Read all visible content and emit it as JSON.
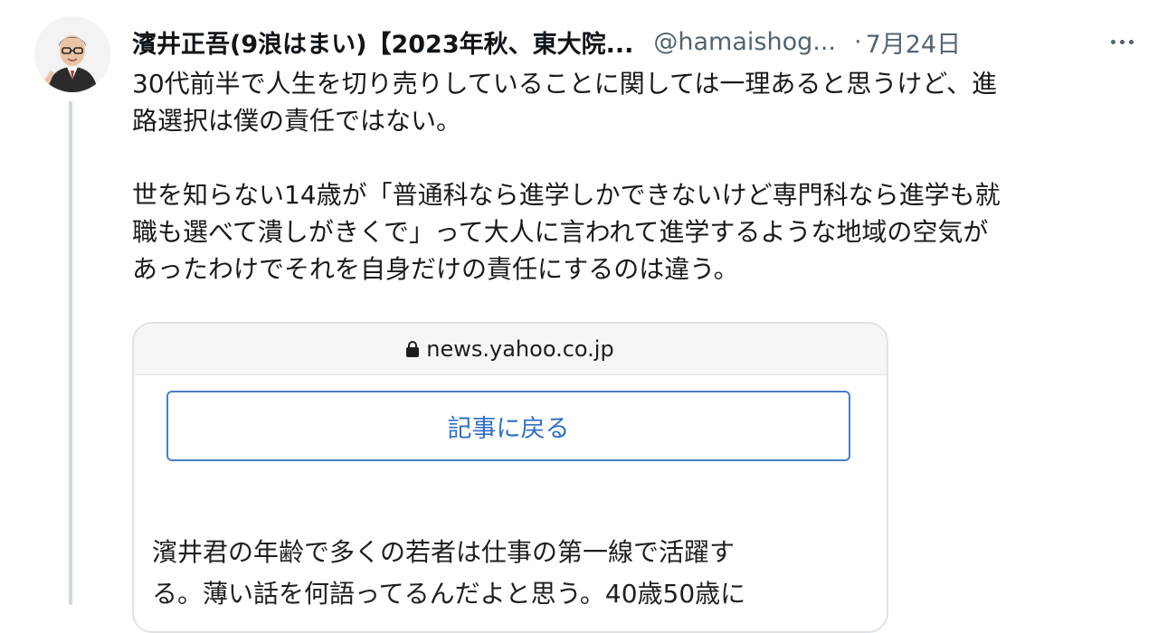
{
  "tweet": {
    "display_name": "濱井正吾(9浪はまい)【2023年秋、東大院...",
    "handle": "@hamaishog...",
    "separator": "·",
    "date": "7月24日",
    "body_lines": [
      "30代前半で人生を切り売りしていることに関しては一理あると思うけど、進",
      "路選択は僕の責任ではない。"
    ],
    "body_lines_2": [
      "世を知らない14歳が「普通科なら進学しかできないけど専門科なら進学も就",
      "職も選べて潰しがきくで」って大人に言われて進学するような地域の空気が",
      "あったわけでそれを自身だけの責任にするのは違う。"
    ]
  },
  "card": {
    "url": "news.yahoo.co.jp",
    "back_button_label": "記事に戻る",
    "article_lines": [
      "濱井君の年齢で多くの若者は仕事の第一線で活躍す",
      "る。薄い話を何語ってるんだよと思う。40歳50歳に"
    ]
  },
  "icons": {
    "more": "more-horizontal-icon",
    "lock": "lock-icon",
    "avatar": "avatar"
  },
  "colors": {
    "link_blue": "#2e6fc4",
    "muted": "#536471",
    "thread_line": "#cfd9de"
  }
}
